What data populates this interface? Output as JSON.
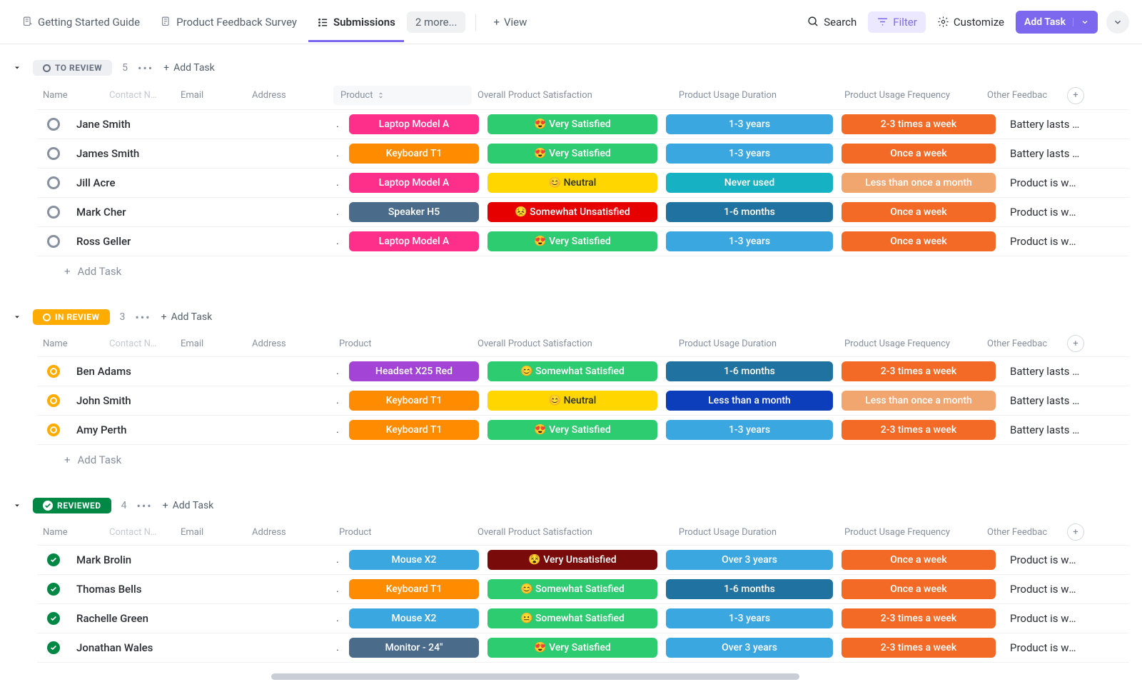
{
  "topbar": {
    "tabs": [
      {
        "label": "Getting Started Guide",
        "icon": "doc"
      },
      {
        "label": "Product Feedback Survey",
        "icon": "form"
      },
      {
        "label": "Submissions",
        "icon": "list",
        "active": true
      }
    ],
    "more_label": "2 more...",
    "add_view_label": "View",
    "search_label": "Search",
    "filter_label": "Filter",
    "customize_label": "Customize",
    "add_task_label": "Add Task"
  },
  "columns": {
    "name": "Name",
    "contact": "Contact N…",
    "email": "Email",
    "address": "Address",
    "product": "Product",
    "satisfaction": "Overall Product Satisfaction",
    "duration": "Product Usage Duration",
    "frequency": "Product Usage Frequency",
    "feedback": "Other Feedbac"
  },
  "add_task_text": "Add Task",
  "groups": [
    {
      "id": "to-review",
      "status_label": "TO REVIEW",
      "status_bg": "#eeeff2",
      "status_color": "#656f7d",
      "count": "5",
      "product_highlight": true,
      "row_status_class": "review",
      "rows": [
        {
          "name": "Jane Smith",
          "product": {
            "t": "Laptop Model A",
            "c": "#fd2f8b"
          },
          "sat": {
            "t": "😍 Very Satisfied",
            "c": "#2ecc71"
          },
          "dur": {
            "t": "1-3 years",
            "c": "#3aa7e0"
          },
          "freq": {
            "t": "2-3 times a week",
            "c": "#f26a25"
          },
          "fb": "Battery lasts …"
        },
        {
          "name": "James Smith",
          "product": {
            "t": "Keyboard T1",
            "c": "#ff8b00"
          },
          "sat": {
            "t": "😍 Very Satisfied",
            "c": "#2ecc71"
          },
          "dur": {
            "t": "1-3 years",
            "c": "#3aa7e0"
          },
          "freq": {
            "t": "Once a week",
            "c": "#f26a25"
          },
          "fb": "Battery lasts …"
        },
        {
          "name": "Jill Acre",
          "product": {
            "t": "Laptop Model A",
            "c": "#fd2f8b"
          },
          "sat": {
            "t": "😊 Neutral",
            "c": "#ffd600",
            "tc": "#2a2e34"
          },
          "dur": {
            "t": "Never used",
            "c": "#17b1c4"
          },
          "freq": {
            "t": "Less than once a month",
            "c": "#f2a66f"
          },
          "fb": "Product is wor…"
        },
        {
          "name": "Mark Cher",
          "product": {
            "t": "Speaker H5",
            "c": "#4a6b8a"
          },
          "sat": {
            "t": "😣 Somewhat Unsatisfied",
            "c": "#e60000"
          },
          "dur": {
            "t": "1-6 months",
            "c": "#2073a1"
          },
          "freq": {
            "t": "Once a week",
            "c": "#f26a25"
          },
          "fb": "Product is wor…"
        },
        {
          "name": "Ross Geller",
          "product": {
            "t": "Laptop Model A",
            "c": "#fd2f8b"
          },
          "sat": {
            "t": "😍 Very Satisfied",
            "c": "#2ecc71"
          },
          "dur": {
            "t": "1-3 years",
            "c": "#3aa7e0"
          },
          "freq": {
            "t": "Once a week",
            "c": "#f26a25"
          },
          "fb": "Product is wor…"
        }
      ]
    },
    {
      "id": "in-review",
      "status_label": "IN REVIEW",
      "status_bg": "#ffab00",
      "status_color": "#fff",
      "count": "3",
      "row_status_class": "inreview",
      "rows": [
        {
          "name": "Ben Adams",
          "product": {
            "t": "Headset X25 Red",
            "c": "#a344d6"
          },
          "sat": {
            "t": "😊 Somewhat Satisfied",
            "c": "#2ecc71"
          },
          "dur": {
            "t": "1-6 months",
            "c": "#2073a1"
          },
          "freq": {
            "t": "2-3 times a week",
            "c": "#f26a25"
          },
          "fb": "Battery lasts …"
        },
        {
          "name": "John Smith",
          "product": {
            "t": "Keyboard T1",
            "c": "#ff8b00"
          },
          "sat": {
            "t": "😊 Neutral",
            "c": "#ffd600",
            "tc": "#2a2e34"
          },
          "dur": {
            "t": "Less than a month",
            "c": "#0c3ebb"
          },
          "freq": {
            "t": "Less than once a month",
            "c": "#f2a66f"
          },
          "fb": "Battery lasts …"
        },
        {
          "name": "Amy Perth",
          "product": {
            "t": "Keyboard T1",
            "c": "#ff8b00"
          },
          "sat": {
            "t": "😍 Very Satisfied",
            "c": "#2ecc71"
          },
          "dur": {
            "t": "1-3 years",
            "c": "#3aa7e0"
          },
          "freq": {
            "t": "2-3 times a week",
            "c": "#f26a25"
          },
          "fb": "Battery lasts …"
        }
      ]
    },
    {
      "id": "reviewed",
      "status_label": "REVIEWED",
      "status_bg": "#008844",
      "status_color": "#fff",
      "status_check": true,
      "count": "4",
      "row_status_class": "reviewed",
      "rows": [
        {
          "name": "Mark Brolin",
          "product": {
            "t": "Mouse X2",
            "c": "#3aa7e0"
          },
          "sat": {
            "t": "😵 Very Unsatisfied",
            "c": "#7a0b0b"
          },
          "dur": {
            "t": "Over 3 years",
            "c": "#3aa7e0"
          },
          "freq": {
            "t": "Once a week",
            "c": "#f26a25"
          },
          "fb": "Product is wor…"
        },
        {
          "name": "Thomas Bells",
          "product": {
            "t": "Keyboard T1",
            "c": "#ff8b00"
          },
          "sat": {
            "t": "😊 Somewhat Satisfied",
            "c": "#2ecc71"
          },
          "dur": {
            "t": "1-6 months",
            "c": "#2073a1"
          },
          "freq": {
            "t": "Once a week",
            "c": "#f26a25"
          },
          "fb": "Product is wor…"
        },
        {
          "name": "Rachelle Green",
          "product": {
            "t": "Mouse X2",
            "c": "#3aa7e0"
          },
          "sat": {
            "t": "😐 Somewhat Satisfied",
            "c": "#2ecc71"
          },
          "dur": {
            "t": "1-3 years",
            "c": "#3aa7e0"
          },
          "freq": {
            "t": "2-3 times a week",
            "c": "#f26a25"
          },
          "fb": "Product is wor…"
        },
        {
          "name": "Jonathan Wales",
          "product": {
            "t": "Monitor - 24\"",
            "c": "#4a6b8a"
          },
          "sat": {
            "t": "😍 Very Satisfied",
            "c": "#2ecc71"
          },
          "dur": {
            "t": "Over 3 years",
            "c": "#3aa7e0"
          },
          "freq": {
            "t": "2-3 times a week",
            "c": "#f26a25"
          },
          "fb": "Product is wor…"
        }
      ]
    }
  ]
}
